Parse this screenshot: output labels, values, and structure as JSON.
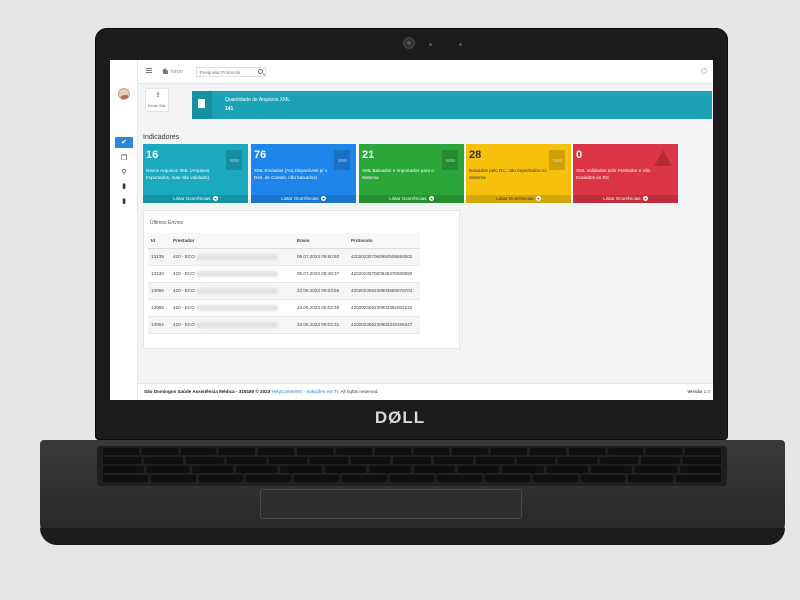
{
  "device": {
    "brand": "DØLL"
  },
  "topbar": {
    "home_label": "Início",
    "search_placeholder": "Pesquisar Protocolo"
  },
  "toolbar": {
    "upload_label": "Enviar XML"
  },
  "banner": {
    "title": "Quantidade de Arquivos XML",
    "count": "141"
  },
  "section_title": "Indicadores",
  "cards": [
    {
      "value": "16",
      "description": "Novos Arquivos XML (Arquivos Importados, mas não validado)",
      "footer": "Listar Ocorrências",
      "color": "#1ba9bf"
    },
    {
      "value": "76",
      "description": "XML Enviados (Arq.Disponíveis p/ o Res. de Contas, não baixados)",
      "footer": "Listar Ocorrências",
      "color": "#1e86ea"
    },
    {
      "value": "21",
      "description": "XML Baixados e Importados para o Sistema",
      "footer": "Listar Ocorrências",
      "color": "#2aa63a"
    },
    {
      "value": "28",
      "description": "Baixados pelo RC, não Importados no Sistema",
      "footer": "Listar Ocorrências",
      "color": "#f6c00c"
    },
    {
      "value": "0",
      "description": "XML Validados pelo Prestador e não Enviados ao RC",
      "footer": "Listar Ocorrências",
      "color": "#dc3545"
    }
  ],
  "recent": {
    "title": "Últimos Envios",
    "columns": [
      "Id",
      "Prestador",
      "Envio",
      "Protocolo"
    ],
    "rows": [
      {
        "id": "13139",
        "prestador": "420 - ECO",
        "envio": "06.07.2023 09:50:50",
        "protocolo": "420202307060950508650002"
      },
      {
        "id": "13138",
        "prestador": "420 - ECO",
        "envio": "06.07.2023 09:48:37",
        "protocolo": "420202307060948376939992"
      },
      {
        "id": "13066",
        "prestador": "420 - ECO",
        "envio": "23.06.2023 09:03:55",
        "protocolo": "420202306230903555676704"
      },
      {
        "id": "13065",
        "prestador": "420 - ECO",
        "envio": "23.06.2023 09:03:39",
        "protocolo": "420202306230903392004222"
      },
      {
        "id": "13064",
        "prestador": "420 - ECO",
        "envio": "23.06.2023 09:03:31",
        "protocolo": "420202306230903318166447"
      }
    ]
  },
  "footer": {
    "copyright": "São Domingos Saúde Assistência Médica - 319180 © 2023",
    "link": "HelpCenterWS - Soluções em TI",
    "rights": ". All rights reserved.",
    "version_label": "Versão",
    "version": "1.0"
  }
}
